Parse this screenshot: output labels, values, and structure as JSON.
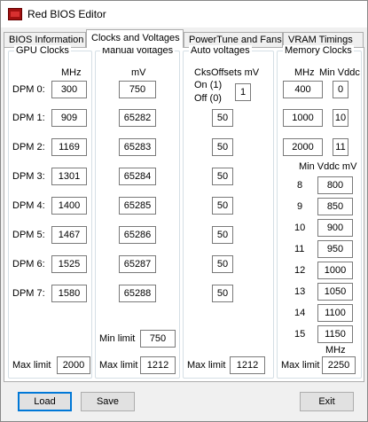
{
  "window": {
    "title": "Red BIOS Editor"
  },
  "tabs": [
    "BIOS Information",
    "Clocks and Voltages",
    "PowerTune and Fans",
    "VRAM Timings"
  ],
  "gpu": {
    "title": "GPU Clocks",
    "unit": "MHz",
    "dpm_labels": [
      "DPM 0:",
      "DPM 1:",
      "DPM 2:",
      "DPM 3:",
      "DPM 4:",
      "DPM 5:",
      "DPM 6:",
      "DPM 7:"
    ],
    "clocks": [
      "300",
      "909",
      "1169",
      "1301",
      "1400",
      "1467",
      "1525",
      "1580"
    ],
    "max_limit_label": "Max limit",
    "max_limit": "2000"
  },
  "manual": {
    "title": "Manual voltages",
    "unit": "mV",
    "values": [
      "750",
      "65282",
      "65283",
      "65284",
      "65285",
      "65286",
      "65287",
      "65288"
    ],
    "min_limit_label": "Min limit",
    "min_limit": "750",
    "max_limit_label": "Max limit",
    "max_limit": "1212"
  },
  "auto": {
    "title": "Auto voltages",
    "header": "CksOffsets mV",
    "on_label": "On (1)",
    "off_label": "Off (0)",
    "toggle": "1",
    "values": [
      "50",
      "50",
      "50",
      "50",
      "50",
      "50",
      "50"
    ],
    "max_limit_label": "Max limit",
    "max_limit": "1212"
  },
  "memory": {
    "title": "Memory Clocks",
    "mhz_label": "MHz",
    "min_vddc_label": "Min Vddc",
    "clocks": [
      "400",
      "1000",
      "2000"
    ],
    "vddc_idx": [
      "0",
      "10",
      "11"
    ],
    "min_vddc_mv_label": "Min Vddc mV",
    "vddc_rows": [
      {
        "index": "8",
        "value": "800"
      },
      {
        "index": "9",
        "value": "850"
      },
      {
        "index": "10",
        "value": "900"
      },
      {
        "index": "11",
        "value": "950"
      },
      {
        "index": "12",
        "value": "1000"
      },
      {
        "index": "13",
        "value": "1050"
      },
      {
        "index": "14",
        "value": "1100"
      },
      {
        "index": "15",
        "value": "1150"
      }
    ],
    "mhz_label_bottom": "MHz",
    "max_limit_label": "Max limit",
    "max_limit": "2250"
  },
  "buttons": {
    "load": "Load",
    "save": "Save",
    "exit": "Exit"
  }
}
